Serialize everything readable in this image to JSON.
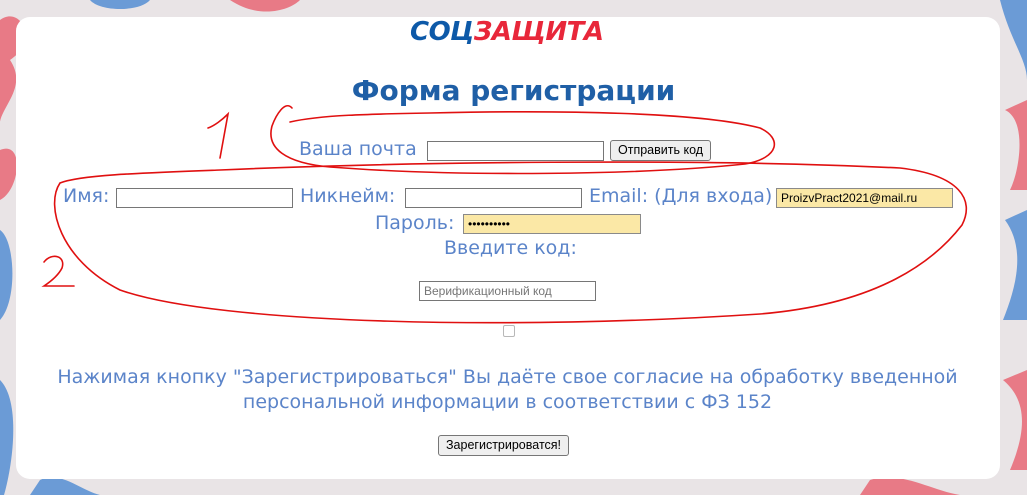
{
  "logo": {
    "part1": "СОЦ",
    "part2": "ЗАЩИТА"
  },
  "form": {
    "title": "Форма регистрации",
    "email_label": "Ваша почта",
    "email_value": "",
    "send_code_button": "Отправить код",
    "name_label": "Имя:",
    "nickname_label": "Никнейм:",
    "login_email_label": "Email: (Для входа)",
    "login_email_value": "ProizvPract2021@mail.ru",
    "password_label": "Пароль:",
    "password_value": "••••••••••",
    "enter_code_label": "Введите код:",
    "code_placeholder": "Верификационный код",
    "consent_line1": "Нажимая кнопку \"Зарегистрироваться\" Вы даёте свое согласие на обработку введенной",
    "consent_line2": "персональной информации в соответствии с ФЗ 152",
    "register_button": "Зарегистрироватся!"
  },
  "annotations": {
    "marker1": "1",
    "marker2": "2"
  },
  "colors": {
    "brand_blue": "#0d59a8",
    "brand_red": "#e8273a",
    "label_blue": "#5b84c9",
    "autofill": "#fbe8a6",
    "annotation_red": "#e01010"
  }
}
